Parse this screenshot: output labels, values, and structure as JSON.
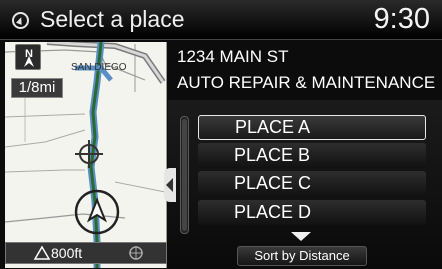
{
  "header": {
    "title": "Select a place",
    "time": "9:30",
    "icon": "navigation-icon"
  },
  "map": {
    "scale_label": "1/8mi",
    "street_label": "SAN DIEGO",
    "distance_label": "800ft",
    "north_icon": "north-up-icon"
  },
  "info": {
    "address": "1234 MAIN  ST",
    "business": "AUTO REPAIR & MAINTENANCE"
  },
  "places": [
    {
      "label": "PLACE A"
    },
    {
      "label": "PLACE B"
    },
    {
      "label": "PLACE C"
    },
    {
      "label": "PLACE D"
    }
  ],
  "sort_label": "Sort by Distance"
}
